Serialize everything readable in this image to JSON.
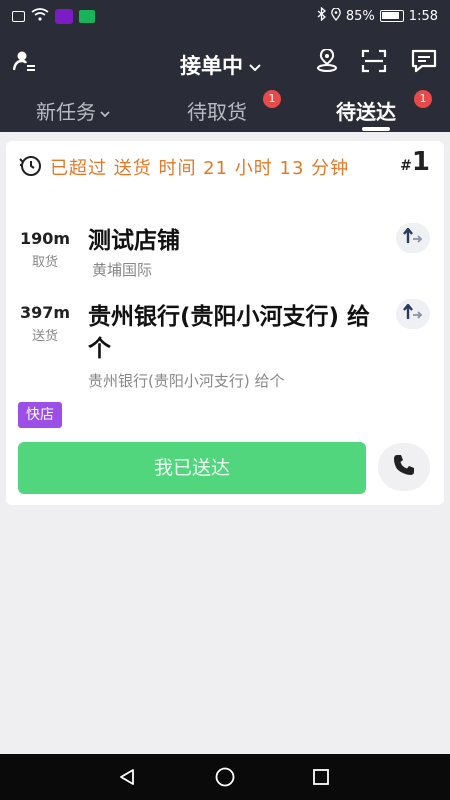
{
  "status_bar": {
    "battery_percent": "85%",
    "time": "1:58",
    "icons": [
      "sim-icon",
      "wifi-icon",
      "notification-app-icon",
      "green-app-icon",
      "bluetooth-icon",
      "location-icon",
      "battery-icon"
    ]
  },
  "header": {
    "title": "接单中",
    "icons": [
      "profile-menu-icon",
      "location-pin-icon",
      "scan-icon",
      "message-icon"
    ]
  },
  "tabs": [
    {
      "label": "新任务",
      "badge": ""
    },
    {
      "label": "待取货",
      "badge": "1"
    },
    {
      "label": "待送达",
      "badge": "1"
    }
  ],
  "order": {
    "overdue_text": "已超过 送货 时间 21 小时 13 分钟",
    "order_no_prefix": "#",
    "order_no": "1",
    "pickup": {
      "distance": "190m",
      "label": "取货",
      "name": "测试店铺",
      "address": "黄埔国际"
    },
    "dropoff": {
      "distance": "397m",
      "label": "送货",
      "name": "贵州银行(贵阳小河支行) 给个",
      "address": "贵州银行(贵阳小河支行) 给个"
    },
    "tag": "快店",
    "deliver_button": "我已送达"
  },
  "colors": {
    "header_bg": "#2a2c38",
    "overdue": "#e07a2a",
    "deliver_button": "#52d67d",
    "tag": "#9b4fe6",
    "badge": "#e84a4a"
  }
}
